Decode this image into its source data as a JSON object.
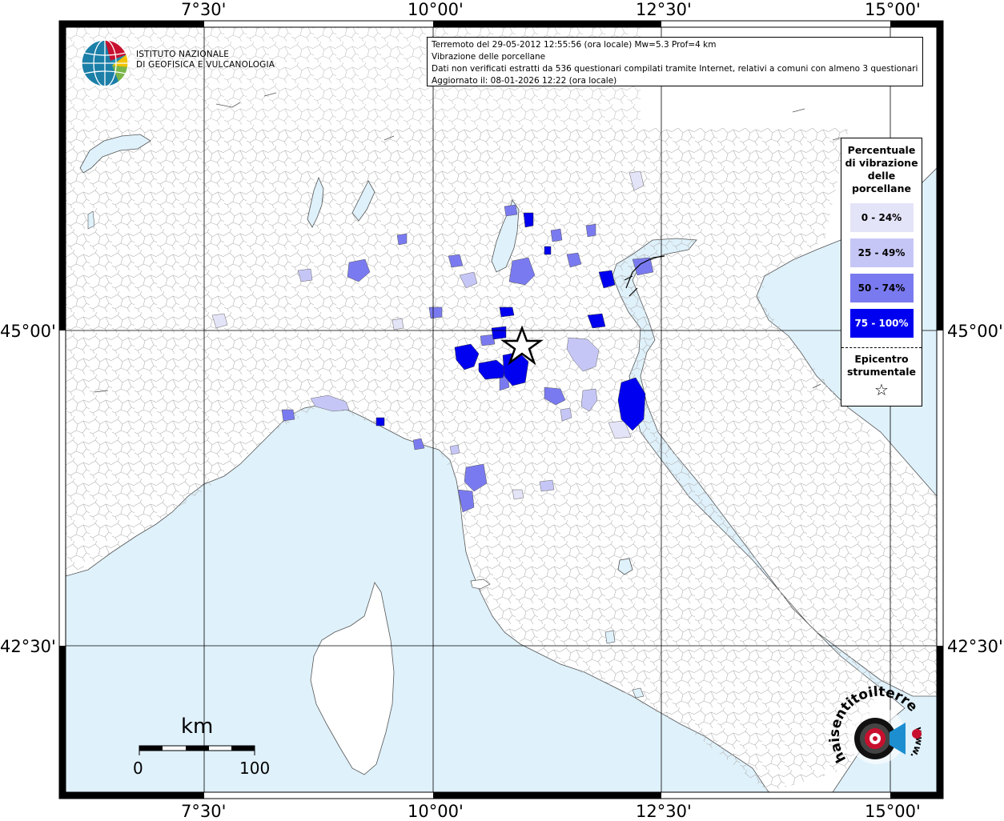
{
  "coords": {
    "lon": [
      "7°30'",
      "10°00'",
      "12°30'",
      "15°00'"
    ],
    "lat": [
      "45°00'",
      "42°30'"
    ]
  },
  "infobox": {
    "line1": "Terremoto del 29-05-2012 12:55:56 (ora locale) Mw=5.3 Prof=4 km",
    "line2": "Vibrazione delle porcellane",
    "line3": "Dati non verificati estratti da 536 questionari compilati tramite Internet, relativi a comuni con almeno 3 questionari.",
    "line4": "Aggiornato il: 08-01-2026 12:22 (ora locale)"
  },
  "legend": {
    "title": [
      "Percentuale",
      "di vibrazione",
      "delle",
      "porcellane"
    ],
    "classes": [
      {
        "label": "0 - 24%",
        "color": "#e4e4f8",
        "text_color": "#000000"
      },
      {
        "label": "25 - 49%",
        "color": "#c6c6f6",
        "text_color": "#000000"
      },
      {
        "label": "50 - 74%",
        "color": "#7a7af0",
        "text_color": "#000000"
      },
      {
        "label": "75 - 100%",
        "color": "#0000f0",
        "text_color": "#ffffff"
      }
    ],
    "epicenter": [
      "Epicentro",
      "strumentale"
    ],
    "star": "☆"
  },
  "logo": {
    "ingv_line1": "ISTITUTO NAZIONALE",
    "ingv_line2": "DI GEOFISICA E VULCANOLOGIA",
    "hst_text": "haisentitoilterremoto.it",
    "hst_www": "www."
  },
  "scale": {
    "unit": "km",
    "min": "0",
    "max": "100"
  },
  "colors": {
    "sea": "#dff1fb",
    "land": "#ffffff",
    "border": "#b0b0b0",
    "frame": "#000000"
  }
}
